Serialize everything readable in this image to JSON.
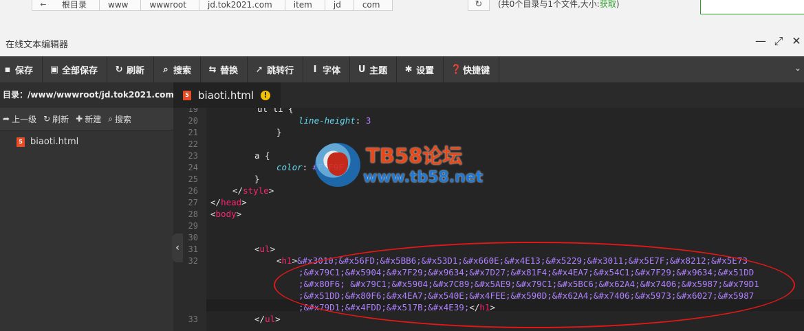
{
  "topbar": {
    "back": "←",
    "crumbs": [
      "根目录",
      "www",
      "wwwroot",
      "jd.tok2021.com",
      "item",
      "jd",
      "com"
    ],
    "refresh": "↻",
    "dir_info_prefix": "(共0个目录与1个文件,大小:",
    "dir_info_link": "获取",
    "dir_info_suffix": ")"
  },
  "window": {
    "title": "在线文本编辑器",
    "minimize": "—",
    "maximize": "⤢",
    "close": "✕"
  },
  "toolbar": {
    "items": [
      {
        "label": "保存",
        "icon": "▪"
      },
      {
        "label": "全部保存",
        "icon": "▣"
      },
      {
        "label": "刷新",
        "icon": "↻"
      },
      {
        "label": "搜索",
        "icon": "⌕"
      },
      {
        "label": "替换",
        "icon": "⇆"
      },
      {
        "label": "跳转行",
        "icon": "➚"
      },
      {
        "label": "字体",
        "icon": "Ⅰ"
      },
      {
        "label": "主题",
        "icon": "U"
      },
      {
        "label": "设置",
        "icon": "✱"
      },
      {
        "label": "快捷键",
        "icon": "❓"
      }
    ],
    "caret": "⌄"
  },
  "sidebar": {
    "path": "目录：/www/wwwroot/jd.tok2021.com/...",
    "actions": [
      {
        "label": "上一级",
        "icon": "➦"
      },
      {
        "label": "刷新",
        "icon": "↻"
      },
      {
        "label": "新建",
        "icon": "✚"
      },
      {
        "label": "搜索",
        "icon": "⌕"
      }
    ],
    "file": "biaoti.html",
    "file_icon": "5"
  },
  "tab": {
    "name": "biaoti.html",
    "warn": "!"
  },
  "editor": {
    "line_numbers": [
      "19",
      "20",
      "21",
      "22",
      "23",
      "24",
      "25",
      "26",
      "27",
      "28",
      "29",
      "30",
      "31",
      "32",
      "33"
    ],
    "collapse": "‹"
  },
  "code_text": {
    "l19": "ul li {",
    "l20_prop": "line-height",
    "l20_colon": ": ",
    "l20_val": "3",
    "l21": "}",
    "l23": "a {",
    "l24_prop": "color",
    "l24_colon": ": ",
    "l24_val": "#F5F9F",
    "l25": "}",
    "l26_open": "</",
    "l26_tag": "style",
    "l26_close": ">",
    "l27_open": "</",
    "l27_tag": "head",
    "l27_close": ">",
    "l28_open": "<",
    "l28_tag": "body",
    "l28_close": ">",
    "l31_open": "<",
    "l31_tag": "ul",
    "l31_close": ">",
    "l32_open": "<",
    "l32_tag": "h1",
    "l32_close": ">",
    "l32_ent1": "&#x3010;&#x56FD;&#x5BB6;&#x53D1;&#x660E;&#x4E13;&#x5229;&#x3011;&#x5E7F;&#x8212;&#x5E73",
    "l32_ent2": ";&#x79C1;&#x5904;&#x7F29;&#x9634;&#x7D27;&#x81F4;&#x4EA7;&#x54C1;&#x7F29;&#x9634;&#x51DD",
    "l32_ent3": ";&#x80F6; &#x79C1;&#x5904;&#x7C89;&#x5AE9;&#x79C1;&#x5BC6;&#x62A4;&#x7406;&#x5987;&#x79D1",
    "l32_ent4": ";&#x51DD;&#x80F6;&#x4EA7;&#x540E;&#x4FEE;&#x590D;&#x62A4;&#x7406;&#x5973;&#x6027;&#x5987",
    "l32_ent5": ";&#x79D1;&#x4FDD;&#x517B;&#x4E39;",
    "l32_end_open": "</",
    "l32_end_tag": "h1",
    "l32_end_close": ">",
    "l33_open": "</",
    "l33_tag": "ul",
    "l33_close": ">"
  },
  "watermark": {
    "title": "TB58论坛",
    "url": "www.tb58.net"
  },
  "colors": {
    "accent_green": "#2a9d2a",
    "annotation_red": "#e01818"
  }
}
